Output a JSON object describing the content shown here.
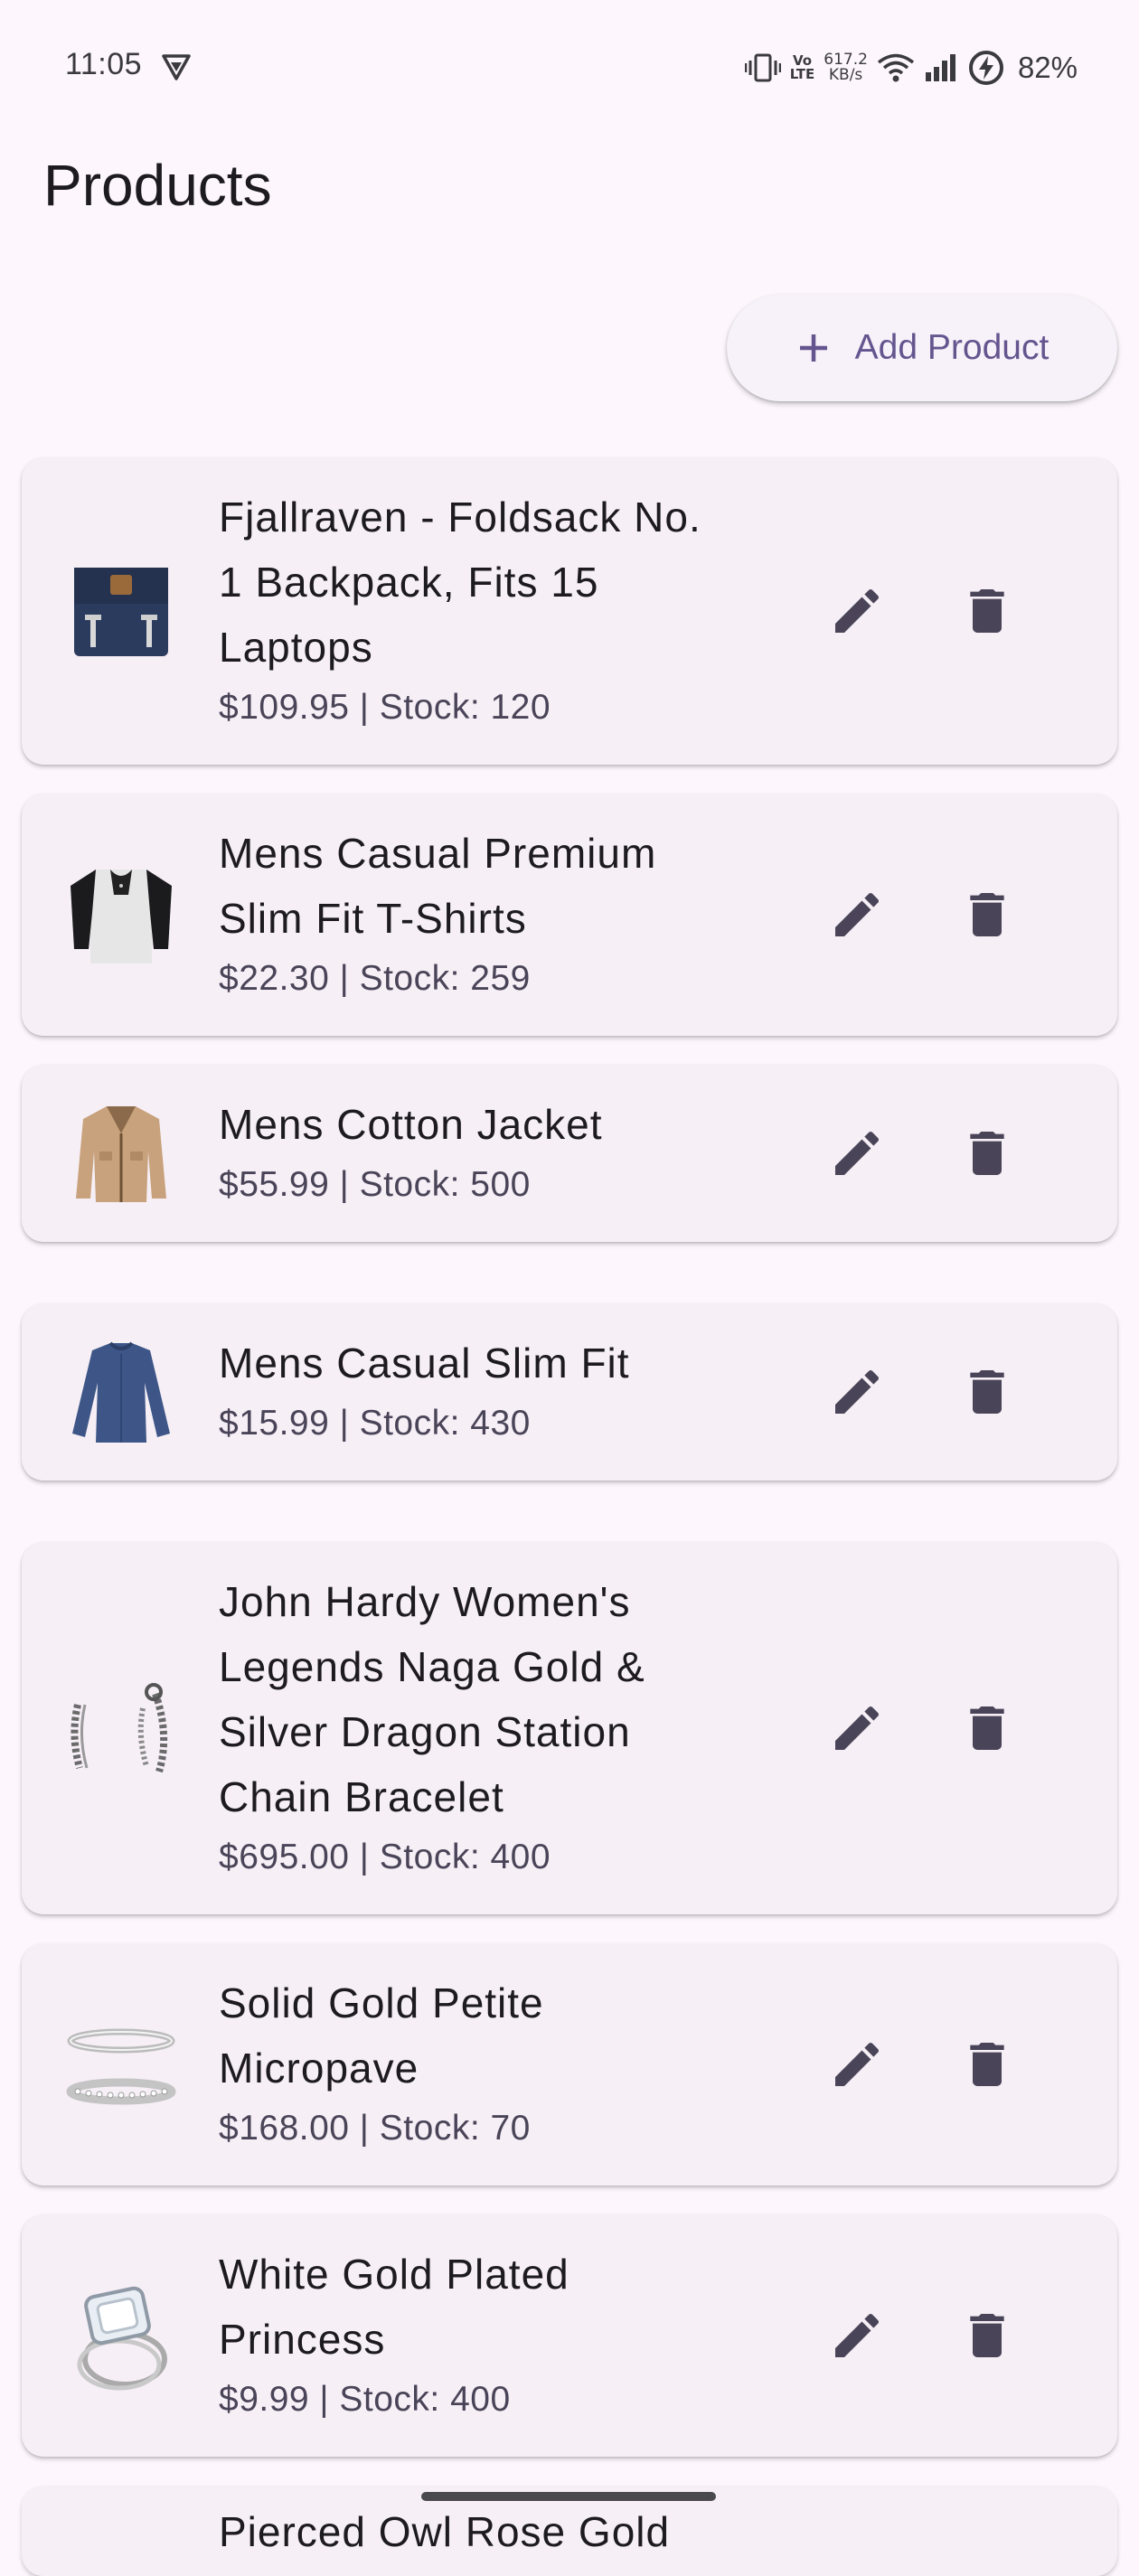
{
  "status_bar": {
    "time": "11:05",
    "network_speed_value": "617.2",
    "network_speed_unit": "KB/s",
    "volte_top": "Vo",
    "volte_bottom": "LTE",
    "battery": "82%",
    "icons": [
      "vpn-icon",
      "vibrate-icon",
      "volte-icon",
      "wifi-icon",
      "signal-icon",
      "battery-charging-icon"
    ]
  },
  "app_bar": {
    "title": "Products"
  },
  "actions": {
    "add_label": "Add Product"
  },
  "colors": {
    "background": "#fdf7fd",
    "card": "#f6eff6",
    "accent": "#65558f",
    "icon": "#4a4458"
  },
  "products": [
    {
      "title_lines": [
        "Fjallraven - Foldsack No.",
        "1 Backpack, Fits 15",
        "Laptops"
      ],
      "meta": "$109.95 | Stock: 120",
      "image": "backpack"
    },
    {
      "title_lines": [
        "Mens Casual Premium",
        "Slim Fit T-Shirts"
      ],
      "meta": "$22.30 | Stock: 259",
      "image": "tshirt"
    },
    {
      "title_lines": [
        "Mens Cotton Jacket"
      ],
      "meta": "$55.99 | Stock: 500",
      "image": "jacket"
    },
    {
      "title_lines": [
        "Mens Casual Slim Fit"
      ],
      "meta": "$15.99 | Stock: 430",
      "image": "longsleeve"
    },
    {
      "title_lines": [
        "John Hardy Women's",
        "Legends Naga Gold &",
        "Silver Dragon Station",
        "Chain Bracelet"
      ],
      "meta": "$695.00 | Stock: 400",
      "image": "bracelet"
    },
    {
      "title_lines": [
        "Solid Gold Petite",
        "Micropave"
      ],
      "meta": "$168.00 | Stock: 70",
      "image": "rings"
    },
    {
      "title_lines": [
        "White Gold Plated",
        "Princess"
      ],
      "meta": "$9.99 | Stock: 400",
      "image": "diamond-ring"
    }
  ],
  "partial_item_title": "Pierced Owl Rose Gold"
}
